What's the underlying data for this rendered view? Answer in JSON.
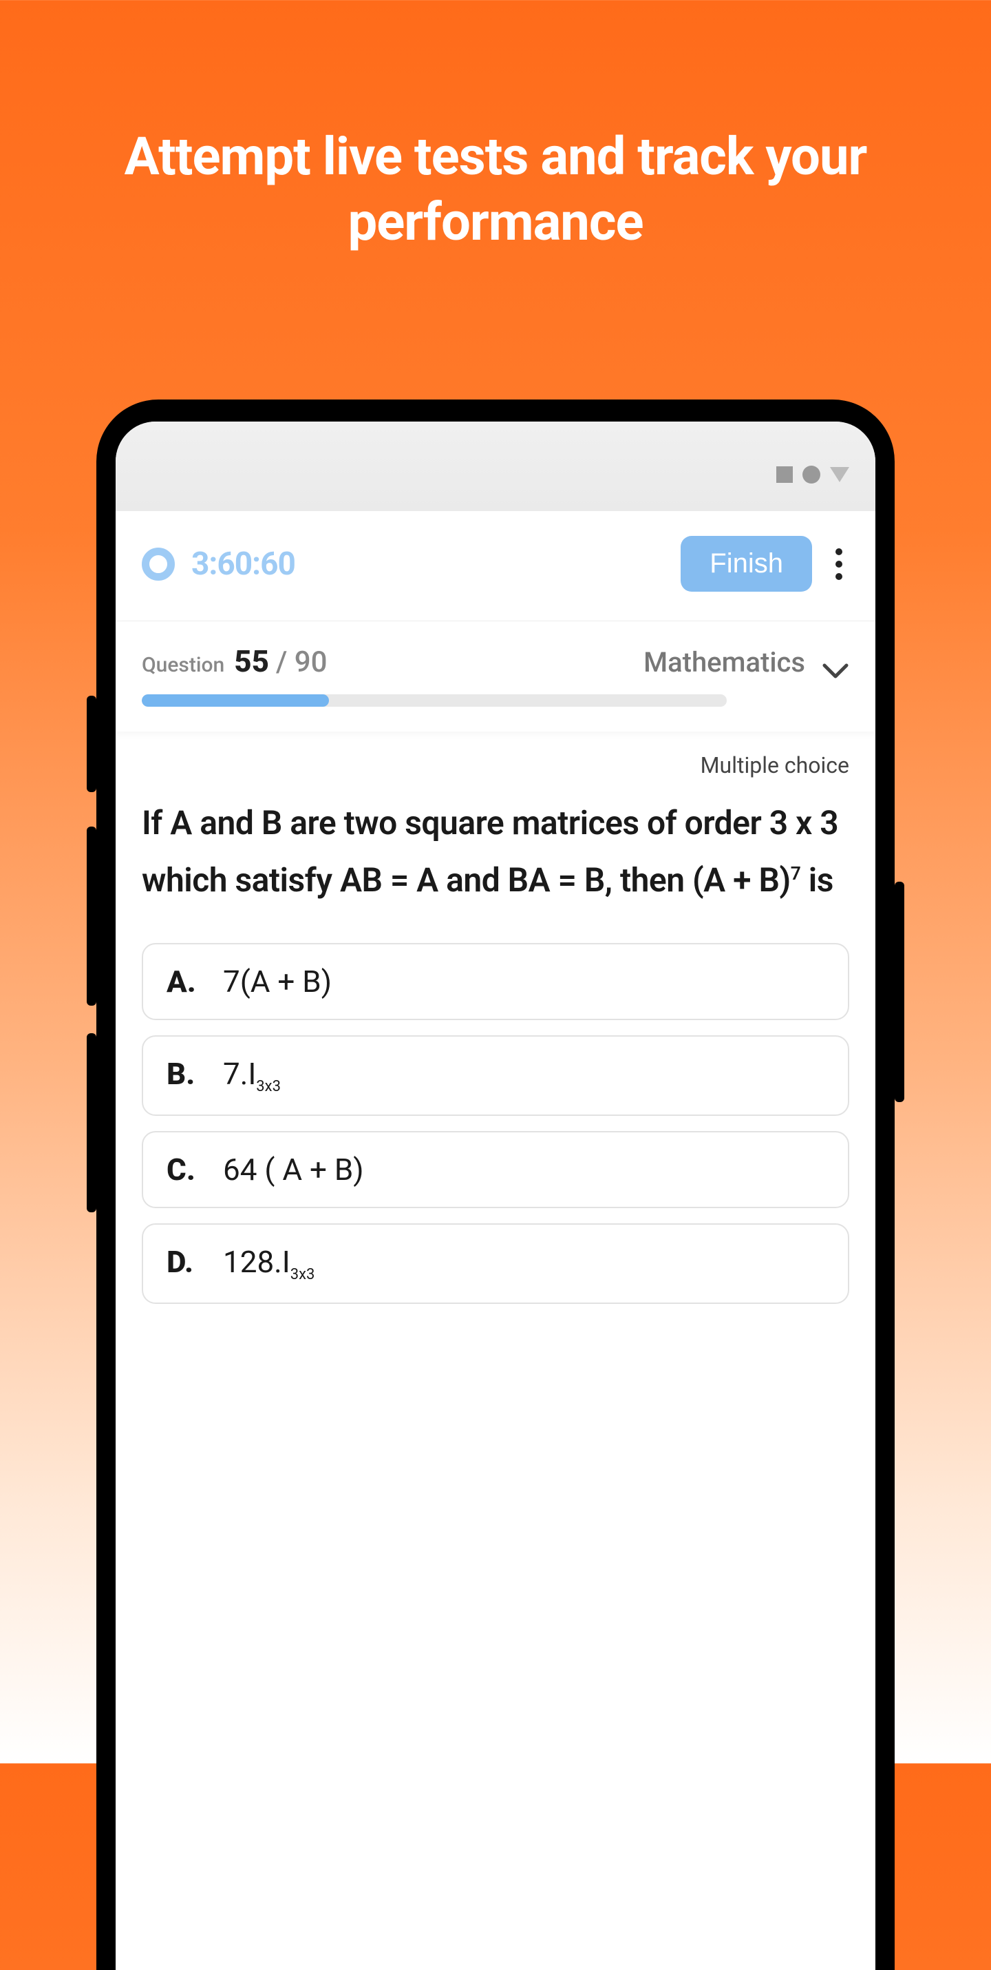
{
  "hero": {
    "title": "Attempt live tests and track your performance"
  },
  "app": {
    "timer": "3:60:60",
    "finish_label": "Finish",
    "question_label": "Question",
    "question_current": "55",
    "question_total": "/ 90",
    "subject": "Mathematics",
    "progress_percent": 32,
    "question_type": "Multiple choice",
    "question_text_html": "If A and B are two square matrices of order 3 x 3 which satisfy AB = A and BA = B, then (A + B)<sup>7</sup> is",
    "options": [
      {
        "letter": "A.",
        "html": "7(A + B)"
      },
      {
        "letter": "B.",
        "html": "7.I<sub>3x3</sub>"
      },
      {
        "letter": "C.",
        "html": "64 ( A + B)"
      },
      {
        "letter": "D.",
        "html": "128.I<sub>3x3</sub>"
      }
    ]
  }
}
